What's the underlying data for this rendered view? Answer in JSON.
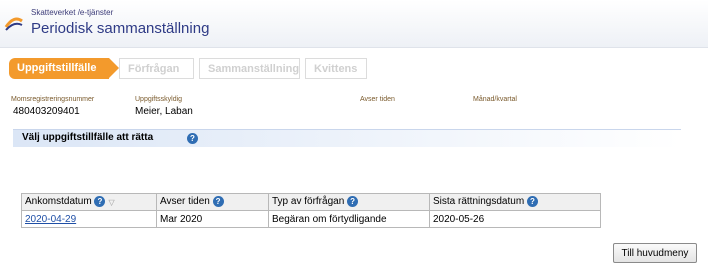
{
  "header": {
    "subtitle": "Skatteverket /e-tjänster",
    "title": "Periodisk sammanställning"
  },
  "steps": [
    "Uppgiftstillfälle",
    "Förfrågan",
    "Sammanställning",
    "Kvittens"
  ],
  "fields": {
    "vat_label": "Momsregistreringsnummer",
    "vat_value": "480403209401",
    "obligor_label": "Uppgiftsskyldig",
    "obligor_value": "Meier, Laban",
    "period_label": "Avser tiden",
    "month_label": "Månad/kvartal"
  },
  "section": {
    "title": "Välj uppgiftstillfälle att rätta"
  },
  "table": {
    "headers": [
      "Ankomstdatum",
      "Avser tiden",
      "Typ av förfrågan",
      "Sista rättningsdatum"
    ],
    "rows": [
      [
        "2020-04-29",
        "Mar 2020",
        "Begäran om förtydligande",
        "2020-05-26"
      ]
    ]
  },
  "buttons": {
    "main_menu": "Till huvudmeny"
  },
  "colors": {
    "accent": "#f39a2c",
    "brand": "#2f3b86",
    "link": "#1f4fa6"
  }
}
